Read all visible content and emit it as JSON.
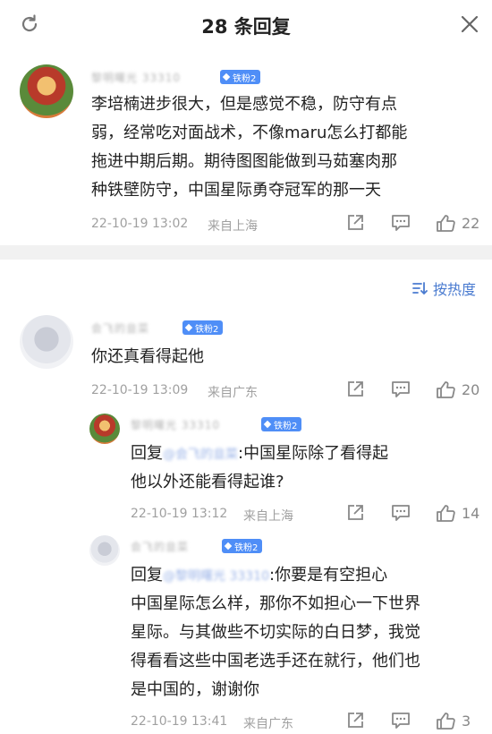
{
  "header": {
    "title": "28 条回复",
    "refresh_icon": "refresh-icon",
    "close_icon": "close-icon"
  },
  "main_comment": {
    "username": "黎明曙光 33310",
    "badge": "铁粉2",
    "text_lines": [
      "李培楠进步很大，但是感觉不稳，防守有点",
      "弱，经常吃对面战术，不像maru怎么打都能",
      "拖进中期后期。期待图图能做到马茹塞肉那",
      "种铁壁防守，中国星际勇夺冠军的那一天"
    ],
    "timestamp": "22-10-19 13:02",
    "location": "来自上海",
    "likes": "22"
  },
  "sort": {
    "label": "按热度",
    "icon": "sort-icon"
  },
  "replies": [
    {
      "username": "会飞的韭菜",
      "badge": "铁粉2",
      "text_lines": [
        "你还真看得起他"
      ],
      "timestamp": "22-10-19 13:09",
      "location": "来自广东",
      "likes": "20"
    },
    {
      "username": "黎明曙光 33310",
      "badge": "铁粉2",
      "reply_prefix": "回复",
      "reply_to": "@会飞的韭菜",
      "text_first": ":中国星际除了看得起",
      "text_lines": [
        "他以外还能看得起谁?"
      ],
      "timestamp": "22-10-19 13:12",
      "location": "来自上海",
      "likes": "14"
    },
    {
      "username": "会飞的韭菜",
      "badge": "铁粉2",
      "reply_prefix": "回复",
      "reply_to": "@黎明曙光 33310",
      "text_first": ":你要是有空担心",
      "text_lines": [
        "中国星际怎么样，那你不如担心一下世界",
        "星际。与其做些不切实际的白日梦，我觉",
        "得看看这些中国老选手还在就行，他们也",
        "是中国的，谢谢你"
      ],
      "timestamp": "22-10-19 13:41",
      "location": "来自广东",
      "likes": "3"
    }
  ],
  "colors": {
    "badge": "#4f8ef7",
    "divider": "#f1f1f1",
    "meta": "#a0a0a0",
    "link": "#4a7bd0"
  }
}
